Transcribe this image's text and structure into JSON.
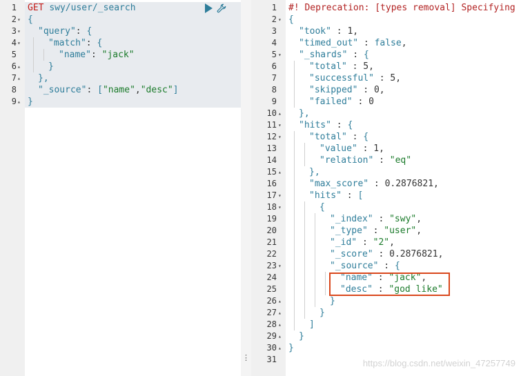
{
  "request": {
    "method": "GET",
    "url": "swy/user/_search",
    "lines": [
      {
        "n": "1",
        "fold": "",
        "indent": 0,
        "tokens": [
          [
            "GET ",
            "m"
          ],
          [
            "swy/user/_search",
            "u"
          ]
        ]
      },
      {
        "n": "2",
        "fold": "▾",
        "indent": 0,
        "tokens": [
          [
            "{",
            "b"
          ]
        ]
      },
      {
        "n": "3",
        "fold": "▾",
        "indent": 1,
        "tokens": [
          [
            "\"query\"",
            "k"
          ],
          [
            ": ",
            "p"
          ],
          [
            "{",
            "b"
          ]
        ]
      },
      {
        "n": "4",
        "fold": "▾",
        "indent": 2,
        "tokens": [
          [
            "\"match\"",
            "k"
          ],
          [
            ": ",
            "p"
          ],
          [
            "{",
            "b"
          ]
        ]
      },
      {
        "n": "5",
        "fold": "",
        "indent": 3,
        "tokens": [
          [
            "\"name\"",
            "k"
          ],
          [
            ": ",
            "p"
          ],
          [
            "\"jack\"",
            "s"
          ]
        ]
      },
      {
        "n": "6",
        "fold": "▴",
        "indent": 2,
        "tokens": [
          [
            "}",
            "b"
          ]
        ]
      },
      {
        "n": "7",
        "fold": "▴",
        "indent": 1,
        "tokens": [
          [
            "},",
            "b"
          ]
        ]
      },
      {
        "n": "8",
        "fold": "",
        "indent": 1,
        "tokens": [
          [
            "\"_source\"",
            "k"
          ],
          [
            ": ",
            "p"
          ],
          [
            "[",
            "b"
          ],
          [
            "\"name\"",
            "s"
          ],
          [
            ",",
            "p"
          ],
          [
            "\"desc\"",
            "s"
          ],
          [
            "]",
            "b"
          ]
        ]
      },
      {
        "n": "9",
        "fold": "▴",
        "indent": 0,
        "tokens": [
          [
            "}",
            "b"
          ]
        ]
      }
    ]
  },
  "response": {
    "lines": [
      {
        "n": "1",
        "fold": "",
        "indent": 0,
        "tokens": [
          [
            "#! Deprecation: [types removal] Specifying types in search requests is deprecated.",
            "c"
          ]
        ]
      },
      {
        "n": "2",
        "fold": "▾",
        "indent": 0,
        "tokens": [
          [
            "{",
            "b"
          ]
        ]
      },
      {
        "n": "3",
        "fold": "",
        "indent": 1,
        "tokens": [
          [
            "\"took\"",
            "k"
          ],
          [
            " : ",
            "p"
          ],
          [
            "1",
            "p"
          ],
          [
            ",",
            "p"
          ]
        ]
      },
      {
        "n": "4",
        "fold": "",
        "indent": 1,
        "tokens": [
          [
            "\"timed_out\"",
            "k"
          ],
          [
            " : ",
            "p"
          ],
          [
            "false",
            "k"
          ],
          [
            ",",
            "p"
          ]
        ]
      },
      {
        "n": "5",
        "fold": "▾",
        "indent": 1,
        "tokens": [
          [
            "\"_shards\"",
            "k"
          ],
          [
            " : ",
            "p"
          ],
          [
            "{",
            "b"
          ]
        ]
      },
      {
        "n": "6",
        "fold": "",
        "indent": 2,
        "tokens": [
          [
            "\"total\"",
            "k"
          ],
          [
            " : ",
            "p"
          ],
          [
            "5",
            "p"
          ],
          [
            ",",
            "p"
          ]
        ]
      },
      {
        "n": "7",
        "fold": "",
        "indent": 2,
        "tokens": [
          [
            "\"successful\"",
            "k"
          ],
          [
            " : ",
            "p"
          ],
          [
            "5",
            "p"
          ],
          [
            ",",
            "p"
          ]
        ]
      },
      {
        "n": "8",
        "fold": "",
        "indent": 2,
        "tokens": [
          [
            "\"skipped\"",
            "k"
          ],
          [
            " : ",
            "p"
          ],
          [
            "0",
            "p"
          ],
          [
            ",",
            "p"
          ]
        ]
      },
      {
        "n": "9",
        "fold": "",
        "indent": 2,
        "tokens": [
          [
            "\"failed\"",
            "k"
          ],
          [
            " : ",
            "p"
          ],
          [
            "0",
            "p"
          ]
        ]
      },
      {
        "n": "10",
        "fold": "▴",
        "indent": 1,
        "tokens": [
          [
            "},",
            "b"
          ]
        ]
      },
      {
        "n": "11",
        "fold": "▾",
        "indent": 1,
        "tokens": [
          [
            "\"hits\"",
            "k"
          ],
          [
            " : ",
            "p"
          ],
          [
            "{",
            "b"
          ]
        ]
      },
      {
        "n": "12",
        "fold": "▾",
        "indent": 2,
        "tokens": [
          [
            "\"total\"",
            "k"
          ],
          [
            " : ",
            "p"
          ],
          [
            "{",
            "b"
          ]
        ]
      },
      {
        "n": "13",
        "fold": "",
        "indent": 3,
        "tokens": [
          [
            "\"value\"",
            "k"
          ],
          [
            " : ",
            "p"
          ],
          [
            "1",
            "p"
          ],
          [
            ",",
            "p"
          ]
        ]
      },
      {
        "n": "14",
        "fold": "",
        "indent": 3,
        "tokens": [
          [
            "\"relation\"",
            "k"
          ],
          [
            " : ",
            "p"
          ],
          [
            "\"eq\"",
            "s"
          ]
        ]
      },
      {
        "n": "15",
        "fold": "▴",
        "indent": 2,
        "tokens": [
          [
            "},",
            "b"
          ]
        ]
      },
      {
        "n": "16",
        "fold": "",
        "indent": 2,
        "tokens": [
          [
            "\"max_score\"",
            "k"
          ],
          [
            " : ",
            "p"
          ],
          [
            "0.2876821",
            "p"
          ],
          [
            ",",
            "p"
          ]
        ]
      },
      {
        "n": "17",
        "fold": "▾",
        "indent": 2,
        "tokens": [
          [
            "\"hits\"",
            "k"
          ],
          [
            " : ",
            "p"
          ],
          [
            "[",
            "b"
          ]
        ]
      },
      {
        "n": "18",
        "fold": "▾",
        "indent": 3,
        "tokens": [
          [
            "{",
            "b"
          ]
        ]
      },
      {
        "n": "19",
        "fold": "",
        "indent": 4,
        "tokens": [
          [
            "\"_index\"",
            "k"
          ],
          [
            " : ",
            "p"
          ],
          [
            "\"swy\"",
            "s"
          ],
          [
            ",",
            "p"
          ]
        ]
      },
      {
        "n": "20",
        "fold": "",
        "indent": 4,
        "tokens": [
          [
            "\"_type\"",
            "k"
          ],
          [
            " : ",
            "p"
          ],
          [
            "\"user\"",
            "s"
          ],
          [
            ",",
            "p"
          ]
        ]
      },
      {
        "n": "21",
        "fold": "",
        "indent": 4,
        "tokens": [
          [
            "\"_id\"",
            "k"
          ],
          [
            " : ",
            "p"
          ],
          [
            "\"2\"",
            "s"
          ],
          [
            ",",
            "p"
          ]
        ]
      },
      {
        "n": "22",
        "fold": "",
        "indent": 4,
        "tokens": [
          [
            "\"_score\"",
            "k"
          ],
          [
            " : ",
            "p"
          ],
          [
            "0.2876821",
            "p"
          ],
          [
            ",",
            "p"
          ]
        ]
      },
      {
        "n": "23",
        "fold": "▾",
        "indent": 4,
        "tokens": [
          [
            "\"_source\"",
            "k"
          ],
          [
            " : ",
            "p"
          ],
          [
            "{",
            "b"
          ]
        ]
      },
      {
        "n": "24",
        "fold": "",
        "indent": 5,
        "tokens": [
          [
            "\"name\"",
            "k"
          ],
          [
            " : ",
            "p"
          ],
          [
            "\"jack\"",
            "s"
          ],
          [
            ",",
            "p"
          ]
        ]
      },
      {
        "n": "25",
        "fold": "",
        "indent": 5,
        "tokens": [
          [
            "\"desc\"",
            "k"
          ],
          [
            " : ",
            "p"
          ],
          [
            "\"god like\"",
            "s"
          ]
        ]
      },
      {
        "n": "26",
        "fold": "▴",
        "indent": 4,
        "tokens": [
          [
            "}",
            "b"
          ]
        ]
      },
      {
        "n": "27",
        "fold": "▴",
        "indent": 3,
        "tokens": [
          [
            "}",
            "b"
          ]
        ]
      },
      {
        "n": "28",
        "fold": "▴",
        "indent": 2,
        "tokens": [
          [
            "]",
            "b"
          ]
        ]
      },
      {
        "n": "29",
        "fold": "▴",
        "indent": 1,
        "tokens": [
          [
            "}",
            "b"
          ]
        ]
      },
      {
        "n": "30",
        "fold": "▴",
        "indent": 0,
        "tokens": [
          [
            "}",
            "b"
          ]
        ]
      },
      {
        "n": "31",
        "fold": "",
        "indent": 0,
        "tokens": []
      }
    ]
  },
  "toolbar": {
    "run_icon": "play-icon",
    "settings_icon": "wrench-icon"
  },
  "splitter": {
    "handle": "⋮"
  },
  "watermark": "https://blog.csdn.net/weixin_47257749",
  "colors": {
    "highlight_border": "#d9461b",
    "key": "#2e7d9a",
    "string": "#1a7a2a",
    "comment": "#b22222",
    "method": "#c41a16"
  }
}
